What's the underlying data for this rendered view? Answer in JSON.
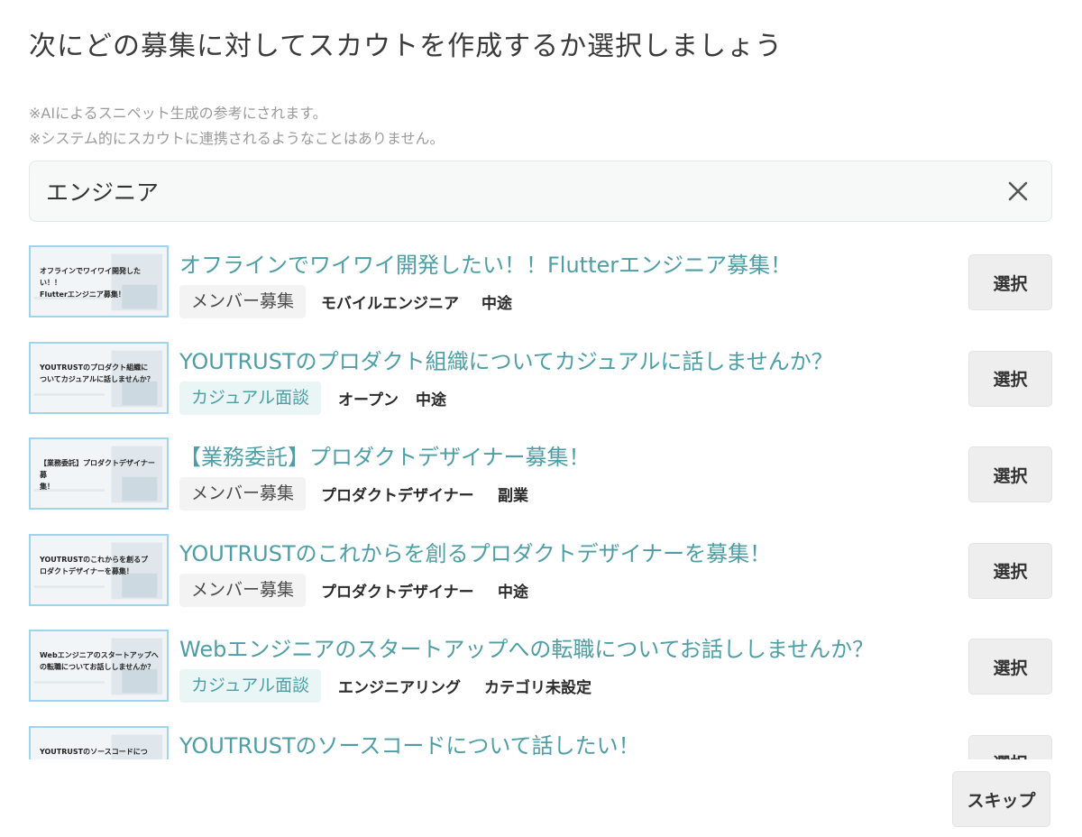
{
  "page": {
    "title": "次にどの募集に対してスカウトを作成するか選択しましょう",
    "note_line1": "※AIによるスニペット生成の参考にされます。",
    "note_line2": "※システム的にスカウトに連携されるようなことはありません。"
  },
  "search": {
    "value": "エンジニア",
    "clear_icon": "close-icon"
  },
  "items": [
    {
      "title": "オフラインでワイワイ開発したい！！Flutterエンジニア募集！",
      "thumb_text": "オフラインでワイワイ開発したい！！\nFlutterエンジニア募集！",
      "tag": "メンバー募集",
      "tag_type": "member",
      "meta1": "モバイルエンジニア",
      "meta2": "中途",
      "button": "選択"
    },
    {
      "title": "YOUTRUSTのプロダクト組織についてカジュアルに話しませんか？",
      "thumb_text": "YOUTRUSTのプロダクト組織に\nついてカジュアルに話しませんか？",
      "tag": "カジュアル面談",
      "tag_type": "casual",
      "meta1": "オープン",
      "meta2": "中途",
      "button": "選択"
    },
    {
      "title": "【業務委託】プロダクトデザイナー募集！",
      "thumb_text": "【業務委託】プロダクトデザイナー募\n集！",
      "tag": "メンバー募集",
      "tag_type": "member",
      "meta1": "プロダクトデザイナー",
      "meta2": "副業",
      "button": "選択"
    },
    {
      "title": "YOUTRUSTのこれからを創るプロダクトデザイナーを募集！",
      "thumb_text": "YOUTRUSTのこれからを創るプ\nロダクトデザイナーを募集！",
      "tag": "メンバー募集",
      "tag_type": "member",
      "meta1": "プロダクトデザイナー",
      "meta2": "中途",
      "button": "選択"
    },
    {
      "title": "Webエンジニアのスタートアップへの転職についてお話ししませんか？",
      "thumb_text": "Webエンジニアのスタートアップへ\nの転職についてお話ししませんか？",
      "tag": "カジュアル面談",
      "tag_type": "casual",
      "meta1": "エンジニアリング",
      "meta2": "カテゴリ未設定",
      "button": "選択"
    },
    {
      "title": "YOUTRUSTのソースコードについて話したい！",
      "thumb_text": "YOUTRUSTのソースコードにつ",
      "tag": "",
      "tag_type": "member",
      "meta1": "",
      "meta2": "",
      "button": "選択"
    }
  ],
  "footer": {
    "skip_label": "スキップ"
  },
  "colors": {
    "link": "#4e9ea6",
    "thumb_border": "#9fd4ea",
    "button_bg": "#eeeeee"
  }
}
